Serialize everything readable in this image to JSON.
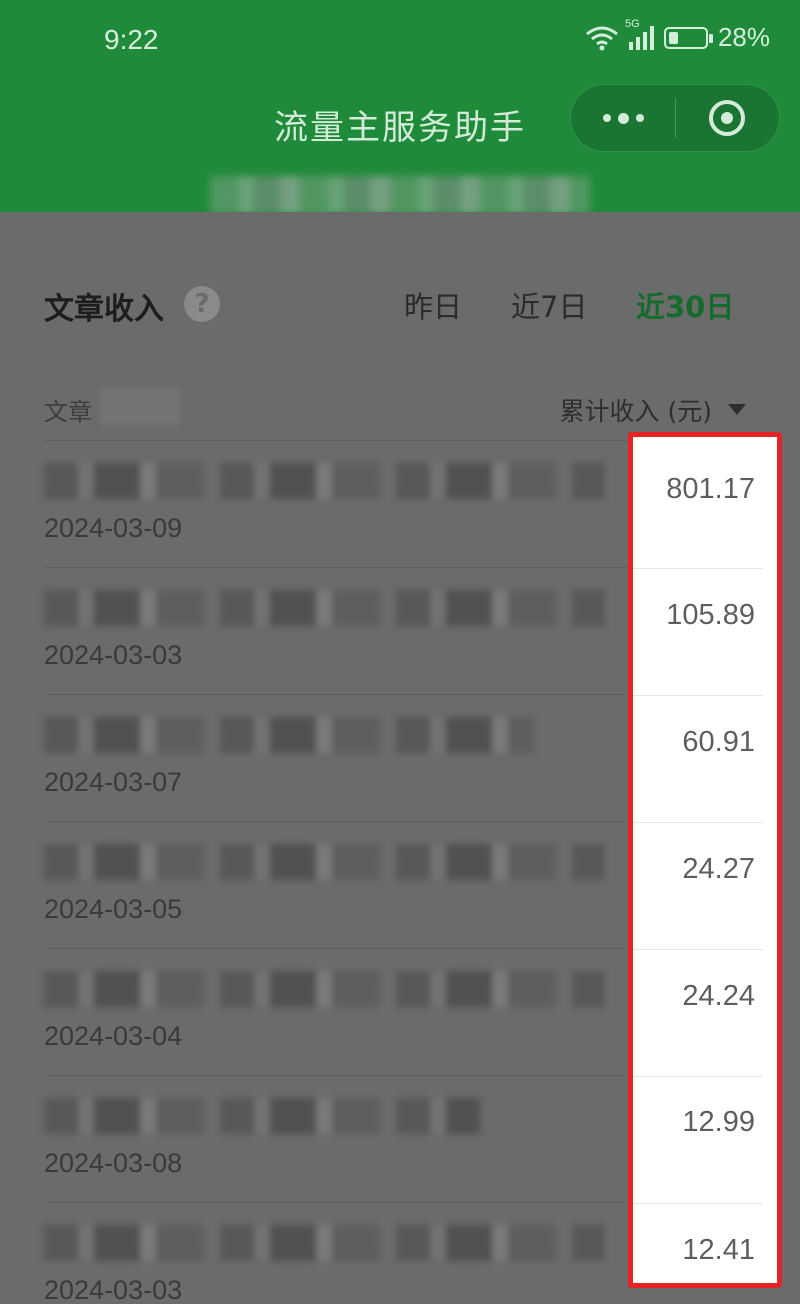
{
  "status_bar": {
    "time": "9:22",
    "network": "5G",
    "battery": "28%",
    "battery_level": 0.28
  },
  "header": {
    "title": "流量主服务助手"
  },
  "section": {
    "title": "文章收入",
    "tabs": [
      {
        "label": "昨日",
        "active": false
      },
      {
        "label": "近7日",
        "active": false
      },
      {
        "label": "近30日",
        "active": true
      }
    ]
  },
  "table": {
    "col_article": "文章",
    "col_income": "累计收入 (元)",
    "rows": [
      {
        "date": "2024-03-09",
        "amount": "801.17"
      },
      {
        "date": "2024-03-03",
        "amount": "105.89"
      },
      {
        "date": "2024-03-07",
        "amount": "60.91"
      },
      {
        "date": "2024-03-05",
        "amount": "24.27"
      },
      {
        "date": "2024-03-04",
        "amount": "24.24"
      },
      {
        "date": "2024-03-08",
        "amount": "12.99"
      },
      {
        "date": "2024-03-03",
        "amount": "12.41"
      }
    ]
  },
  "colors": {
    "header_green": "#1f8a3a",
    "active_tab": "#146b2c",
    "highlight_border": "#e52525"
  }
}
